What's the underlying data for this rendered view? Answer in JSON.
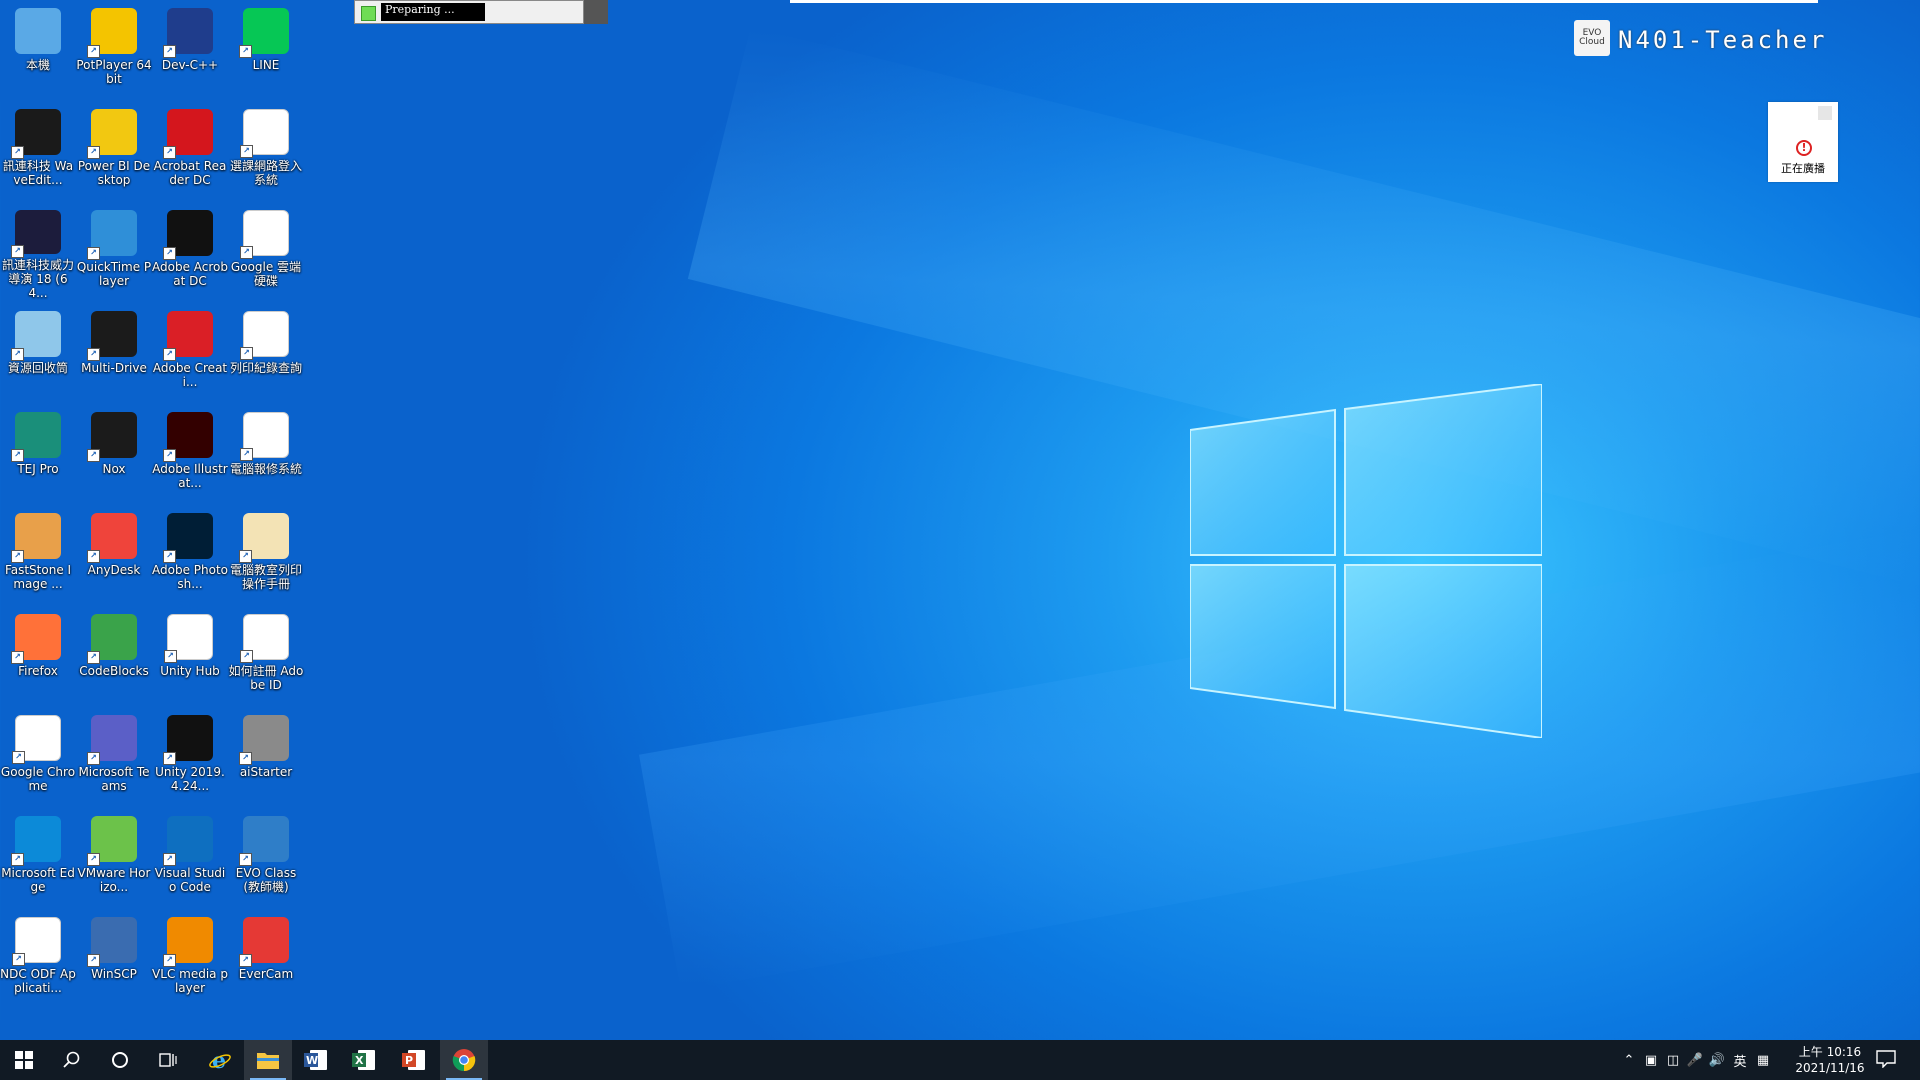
{
  "desktop": {
    "icons": [
      {
        "label": "本機",
        "icon": "computer-icon",
        "color": "#5aa9e6"
      },
      {
        "label": "PotPlayer 64 bit",
        "icon": "potplayer-icon",
        "color": "#f4c400"
      },
      {
        "label": "Dev-C++",
        "icon": "devcpp-icon",
        "color": "#1f3d8c"
      },
      {
        "label": "LINE",
        "icon": "line-icon",
        "color": "#06c755"
      },
      {
        "label": "訊連科技 WaveEdit...",
        "icon": "waveeditor-icon",
        "color": "#1a1a1a"
      },
      {
        "label": "Power BI Desktop",
        "icon": "powerbi-icon",
        "color": "#f2c811"
      },
      {
        "label": "Acrobat Reader DC",
        "icon": "acrobat-reader-icon",
        "color": "#d4161d"
      },
      {
        "label": "選課網路登入系統",
        "icon": "chrome-icon",
        "color": "#ffffff"
      },
      {
        "label": "訊連科技威力導演 18 (64...",
        "icon": "powerdirector-icon",
        "color": "#1c1c3c"
      },
      {
        "label": "QuickTime Player",
        "icon": "quicktime-icon",
        "color": "#2f8fd8"
      },
      {
        "label": "Adobe Acrobat DC",
        "icon": "acrobat-dc-icon",
        "color": "#111111"
      },
      {
        "label": "Google 雲端硬碟",
        "icon": "chrome-icon",
        "color": "#ffffff"
      },
      {
        "label": "資源回收筒",
        "icon": "recycle-bin-icon",
        "color": "#8fc7ea"
      },
      {
        "label": "Multi-Drive",
        "icon": "nox-icon",
        "color": "#1b1b1b"
      },
      {
        "label": "Adobe Creati...",
        "icon": "creative-cloud-icon",
        "color": "#da1f26"
      },
      {
        "label": "列印紀錄查詢",
        "icon": "chrome-icon",
        "color": "#ffffff"
      },
      {
        "label": "TEJ Pro",
        "icon": "tej-icon",
        "color": "#1a8f7a"
      },
      {
        "label": "Nox",
        "icon": "nox-icon",
        "color": "#1b1b1b"
      },
      {
        "label": "Adobe Illustrat...",
        "icon": "illustrator-icon",
        "color": "#330000"
      },
      {
        "label": "電腦報修系統",
        "icon": "chrome-icon",
        "color": "#ffffff"
      },
      {
        "label": "FastStone Image ...",
        "icon": "faststone-icon",
        "color": "#e8a04a"
      },
      {
        "label": "AnyDesk",
        "icon": "anydesk-icon",
        "color": "#ef443b"
      },
      {
        "label": "Adobe Photosh...",
        "icon": "photoshop-icon",
        "color": "#001e36"
      },
      {
        "label": "電腦教室列印操作手冊",
        "icon": "document-icon",
        "color": "#f3e3b5"
      },
      {
        "label": "Firefox",
        "icon": "firefox-icon",
        "color": "#ff7139"
      },
      {
        "label": "CodeBlocks",
        "icon": "codeblocks-icon",
        "color": "#3aa34a"
      },
      {
        "label": "Unity Hub",
        "icon": "unity-hub-icon",
        "color": "#ffffff"
      },
      {
        "label": "如何註冊 Adobe ID",
        "icon": "pdf-icon",
        "color": "#ffffff"
      },
      {
        "label": "Google Chrome",
        "icon": "chrome-icon",
        "color": "#ffffff"
      },
      {
        "label": "Microsoft Teams",
        "icon": "teams-icon",
        "color": "#5b5fc7"
      },
      {
        "label": "Unity 2019.4.24...",
        "icon": "unity-icon",
        "color": "#111111"
      },
      {
        "label": "aiStarter",
        "icon": "android-icon",
        "color": "#8a8a8a"
      },
      {
        "label": "Microsoft Edge",
        "icon": "edge-icon",
        "color": "#0c8ad8"
      },
      {
        "label": "VMware Horizo...",
        "icon": "vmware-horizon-icon",
        "color": "#6cc24a"
      },
      {
        "label": "Visual Studio Code",
        "icon": "vscode-icon",
        "color": "#0e6fc0"
      },
      {
        "label": "EVO Class(教師機)",
        "icon": "evo-class-icon",
        "color": "#2f7ec8"
      },
      {
        "label": "NDC ODF Applicati...",
        "icon": "document-icon",
        "color": "#ffffff"
      },
      {
        "label": "WinSCP",
        "icon": "winscp-icon",
        "color": "#3a6cb0"
      },
      {
        "label": "VLC media player",
        "icon": "vlc-icon",
        "color": "#f08a00"
      },
      {
        "label": "EverCam",
        "icon": "evercam-icon",
        "color": "#e53935"
      }
    ]
  },
  "prep_dialog": {
    "text": "Preparing ..."
  },
  "evo": {
    "badge_top": "EVO",
    "badge_bottom": "Cloud",
    "name": "N401-Teacher"
  },
  "broadcast": {
    "label": "正在廣播"
  },
  "taskbar": {
    "apps": [
      {
        "name": "start-button",
        "icon": "windows-icon"
      },
      {
        "name": "search-button",
        "icon": "search-icon"
      },
      {
        "name": "cortana-button",
        "icon": "cortana-icon"
      },
      {
        "name": "task-view-button",
        "icon": "task-view-icon"
      },
      {
        "name": "ie-button",
        "icon": "ie-icon"
      },
      {
        "name": "file-explorer-button",
        "icon": "folder-icon"
      },
      {
        "name": "word-button",
        "icon": "word-icon"
      },
      {
        "name": "excel-button",
        "icon": "excel-icon"
      },
      {
        "name": "powerpoint-button",
        "icon": "powerpoint-icon"
      },
      {
        "name": "chrome-button",
        "icon": "chrome-icon"
      }
    ],
    "ime": "英",
    "clock_time": "上午 10:16",
    "clock_date": "2021/11/16"
  },
  "colors": {
    "taskbar": "#111a24",
    "desktop": "#0b78e0"
  }
}
